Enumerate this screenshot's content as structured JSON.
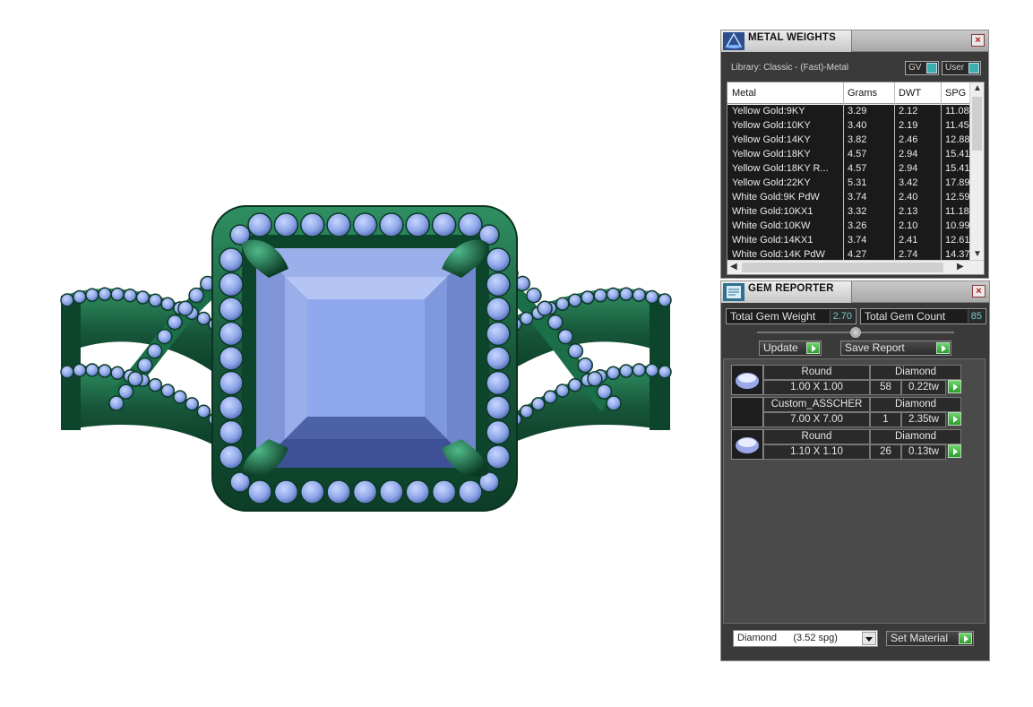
{
  "metal_weights": {
    "title": "METAL WEIGHTS",
    "library_label": "Library: Classic - (Fast)-Metal",
    "toggle_gv": "GV",
    "toggle_user": "User",
    "columns": [
      "Metal",
      "Grams",
      "DWT",
      "SPG"
    ],
    "rows": [
      [
        "Yellow Gold:9KY",
        "3.29",
        "2.12",
        "11.08"
      ],
      [
        "Yellow Gold:10KY",
        "3.40",
        "2.19",
        "11.45"
      ],
      [
        "Yellow Gold:14KY",
        "3.82",
        "2.46",
        "12.88"
      ],
      [
        "Yellow Gold:18KY",
        "4.57",
        "2.94",
        "15.41"
      ],
      [
        "Yellow Gold:18KY R...",
        "4.57",
        "2.94",
        "15.41"
      ],
      [
        "Yellow Gold:22KY",
        "5.31",
        "3.42",
        "17.89"
      ],
      [
        "White Gold:9K PdW",
        "3.74",
        "2.40",
        "12.59"
      ],
      [
        "White Gold:10KX1",
        "3.32",
        "2.13",
        "11.18"
      ],
      [
        "White Gold:10KW",
        "3.26",
        "2.10",
        "10.99"
      ],
      [
        "White Gold:14KX1",
        "3.74",
        "2.41",
        "12.61"
      ],
      [
        "White Gold:14K PdW",
        "4.27",
        "2.74",
        "14.37"
      ]
    ]
  },
  "gem_reporter": {
    "title": "GEM REPORTER",
    "total_weight_label": "Total Gem Weight",
    "total_weight_value": "2.70",
    "total_count_label": "Total Gem Count",
    "total_count_value": "85",
    "update_label": "Update",
    "save_report_label": "Save Report",
    "gems": [
      {
        "shape": "Round",
        "material": "Diamond",
        "size": "1.00 X 1.00",
        "count": "58",
        "weight": "0.22tw",
        "has_thumb": true
      },
      {
        "shape": "Custom_ASSCHER",
        "material": "Diamond",
        "size": "7.00 X 7.00",
        "count": "1",
        "weight": "2.35tw",
        "has_thumb": false
      },
      {
        "shape": "Round",
        "material": "Diamond",
        "size": "1.10 X 1.10",
        "count": "26",
        "weight": "0.13tw",
        "has_thumb": true
      }
    ],
    "material_select": "Diamond      (3.52 spg)",
    "set_material_label": "Set Material"
  },
  "colors": {
    "metal_green": "#1f6b47",
    "gem_blue": "#8ea6e8",
    "panel_bg": "#3a3a3a",
    "go_green": "#3fb53f"
  }
}
